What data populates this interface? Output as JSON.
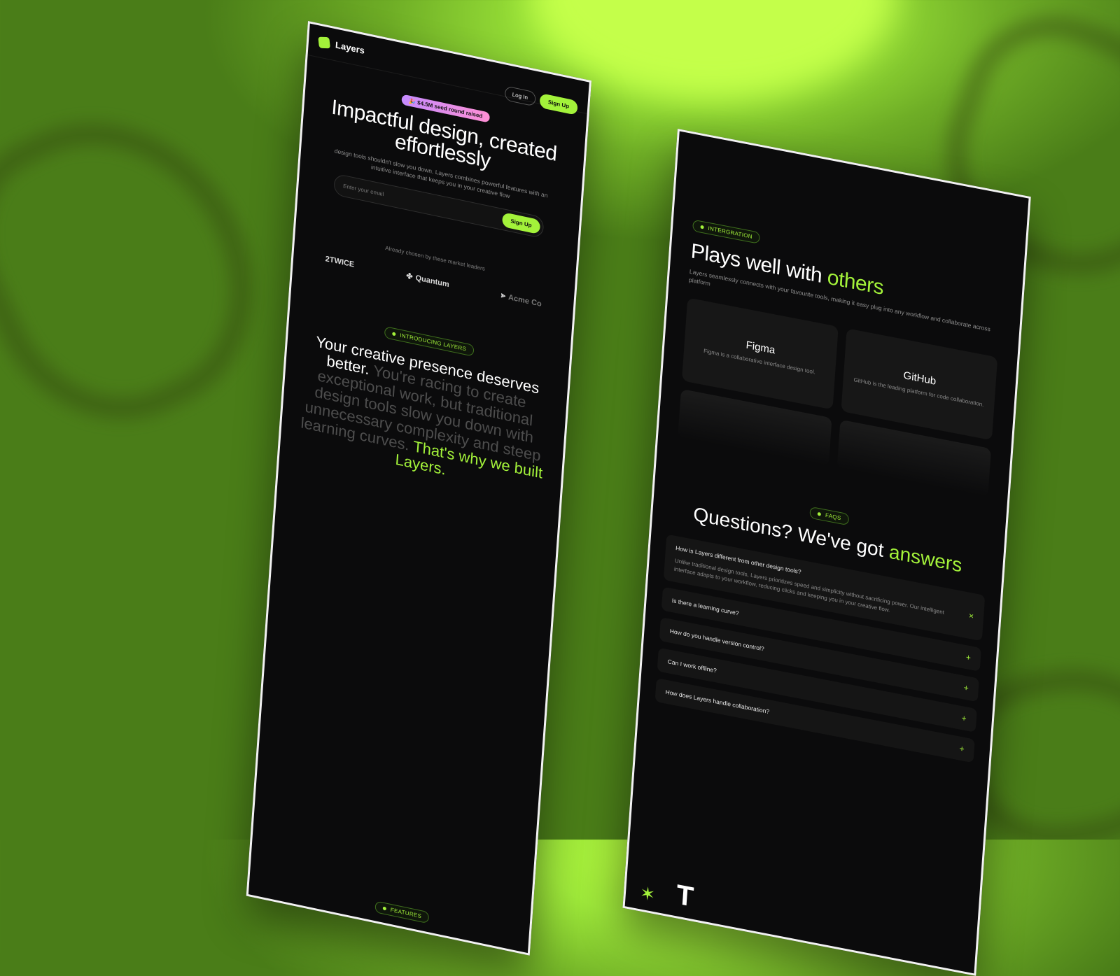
{
  "left_page": {
    "brand": "Layers",
    "nav": {
      "login": "Log In",
      "signup": "Sign Up"
    },
    "hero": {
      "badge": "🎉 $4.5M seed round raised",
      "title": "Impactful design, created effortlessly",
      "subtitle": "design tools shouldn't slow you down. Layers combines powerful features with an intuitive interface that keeps you in your creative flow",
      "email_placeholder": "Enter your email",
      "cta": "Sign Up"
    },
    "logos": {
      "heading": "Already chosen by these market leaders",
      "items": [
        "2TWICE",
        "Quantum",
        "Acme Co"
      ]
    },
    "intro": {
      "tag": "INTRODUCING LAYERS",
      "lead": "Your creative presence deserves better.",
      "body": "You're racing to create exceptional work, but traditional design tools slow you down with unnecessary complexity and steep learning curves.",
      "closing": "That's why we built Layers."
    },
    "footer_tag": "FEATURES"
  },
  "right_page": {
    "integration": {
      "tag": "INTERGRATION",
      "title_start": "Plays well with ",
      "title_accent": "others",
      "subtitle": "Layers seamlessly connects with your favourite tools, making it easy plug into any workflow and collaborate across platform",
      "tiles": [
        {
          "name": "Figma",
          "desc": "Figma is a collaborative interface design tool."
        },
        {
          "name": "GitHub",
          "desc": "GitHub is the leading platform for code collaboration."
        }
      ]
    },
    "faq": {
      "tag": "FAQS",
      "title_start": "Questions? We've got ",
      "title_accent": "answers",
      "items": [
        {
          "q": "How is Layers different from other design tools?",
          "a": "Unlike traditional design tools, Layers prioritizes speed and simplicity without sacrificing power. Our intelligent interface adapts to your workflow, reducing clicks and keeping you in your creative flow.",
          "icon": "×"
        },
        {
          "q": "Is there a learning curve?",
          "icon": "+"
        },
        {
          "q": "How do you handle version control?",
          "icon": "+"
        },
        {
          "q": "Can I work offline?",
          "icon": "+"
        },
        {
          "q": "How does Layers handle collaboration?",
          "icon": "+"
        }
      ]
    },
    "bottom": {
      "star": "✶",
      "letter": "T"
    }
  },
  "colors": {
    "accent": "#a3f23a",
    "page_bg": "#0b0b0c",
    "backdrop": "#9ee83a"
  }
}
